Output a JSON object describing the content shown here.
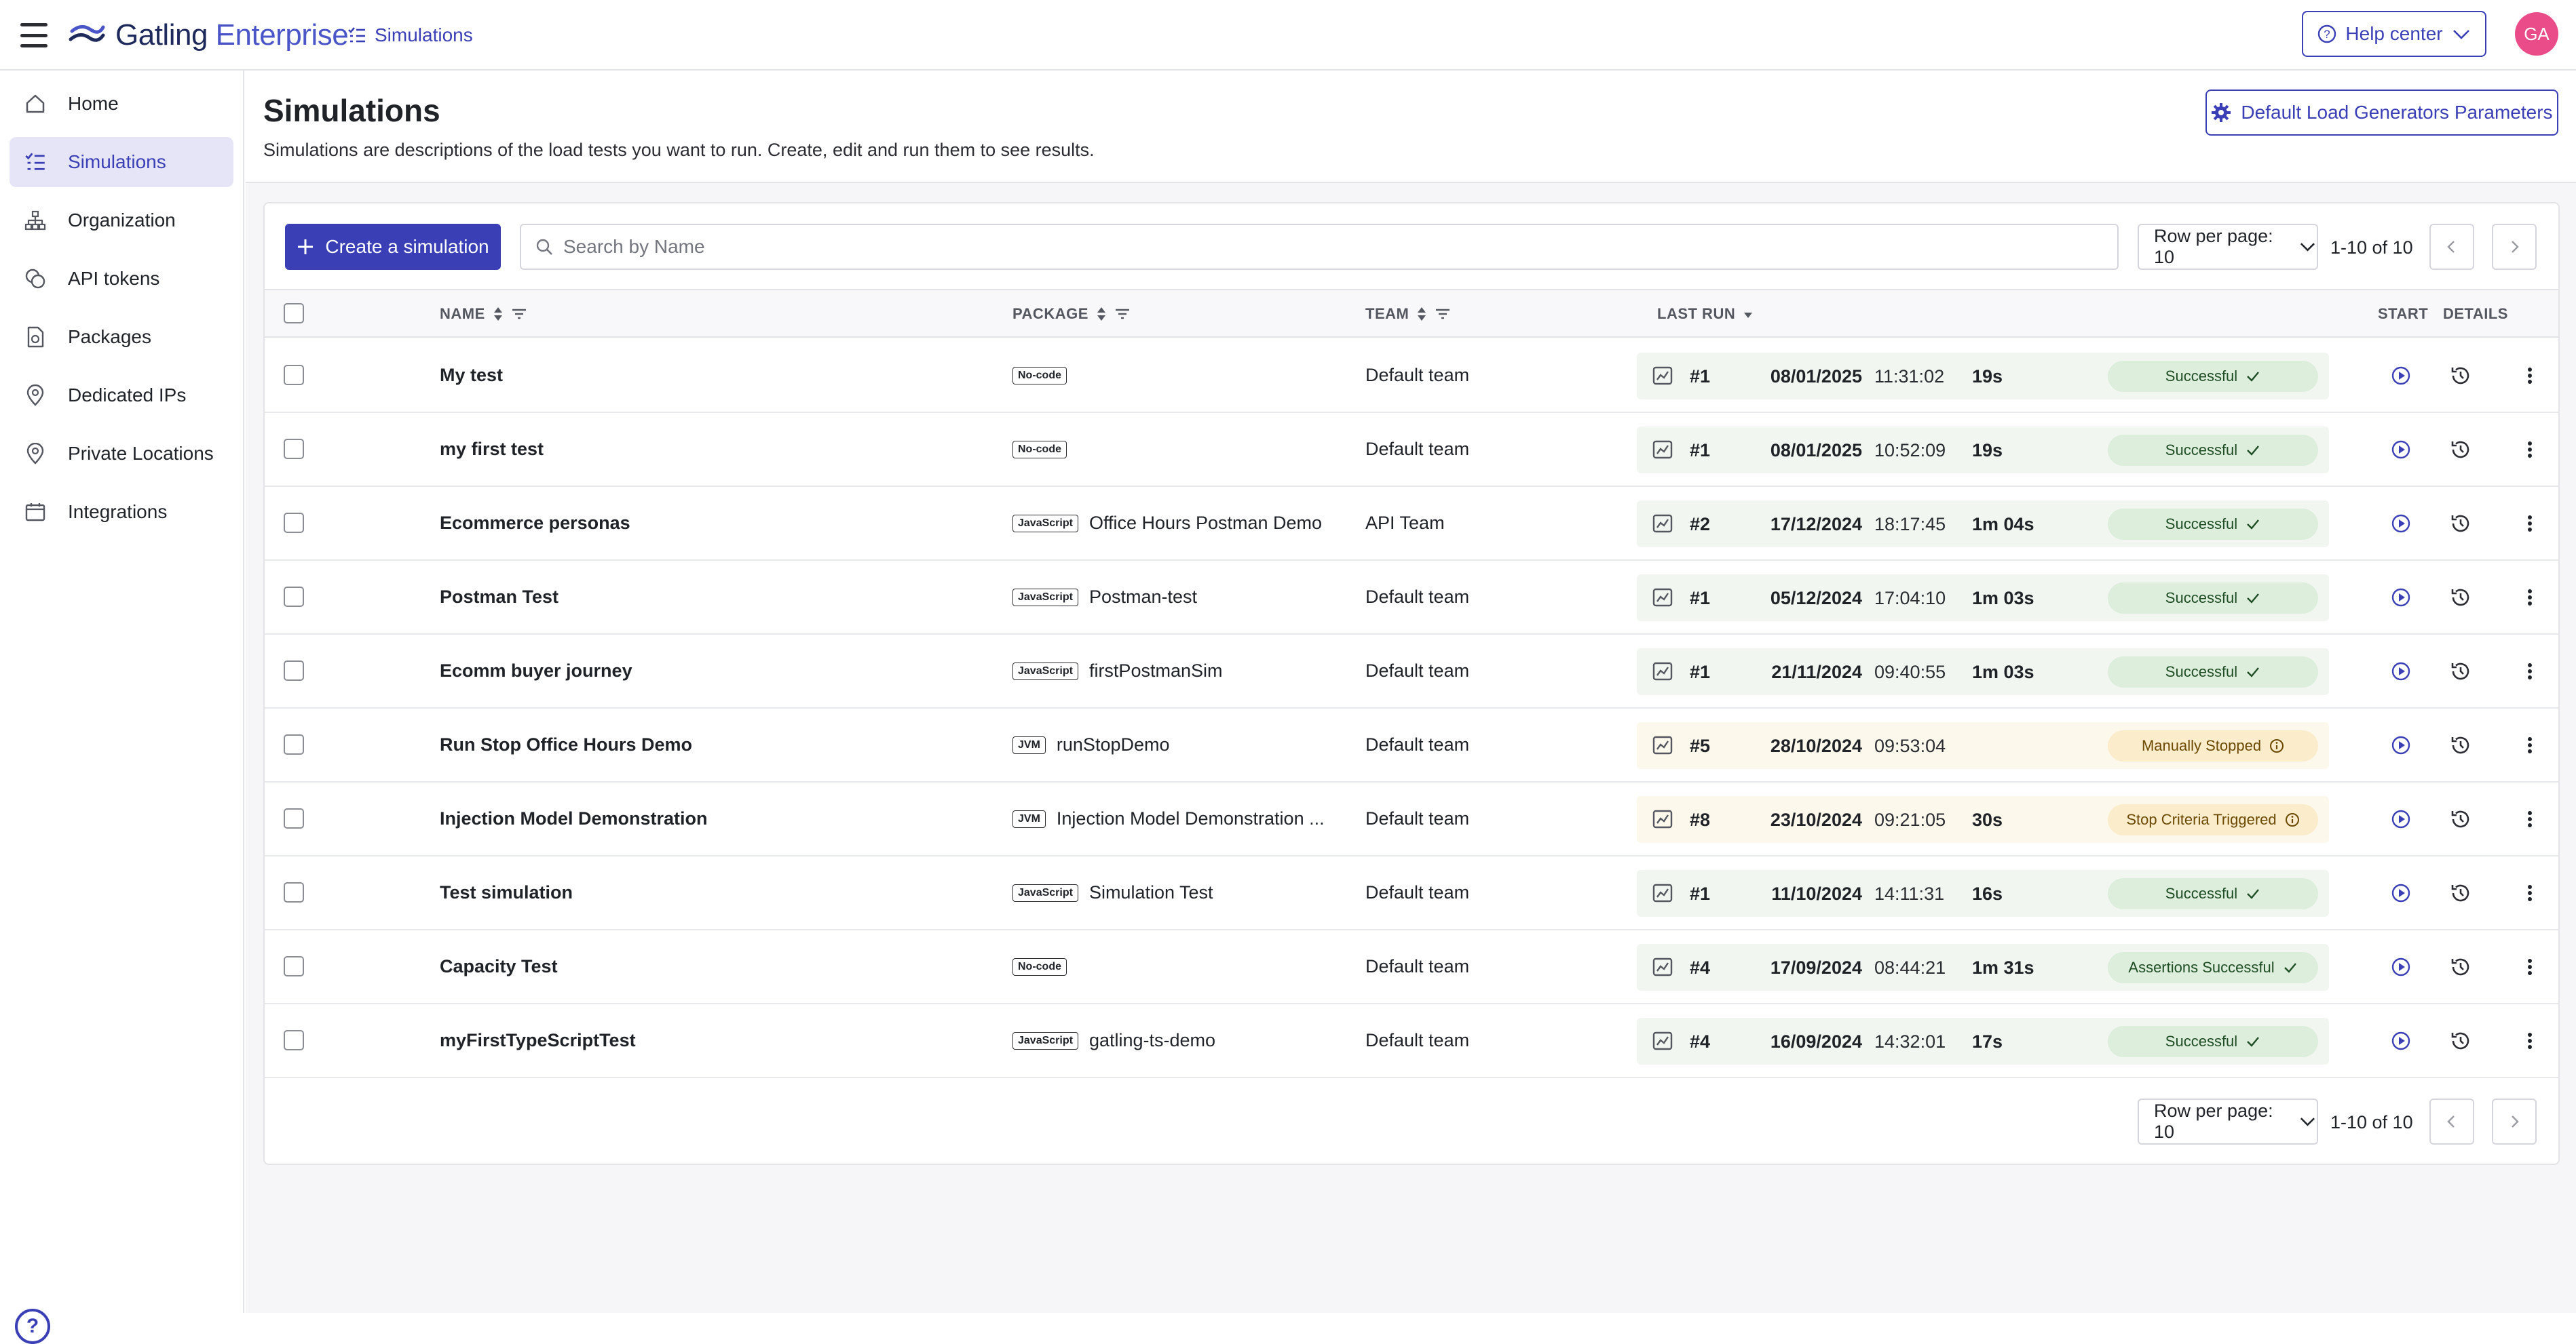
{
  "app": {
    "brand_main": "Gatling",
    "brand_sub": "Enterprise",
    "breadcrumb": "Simulations",
    "help_center": "Help center",
    "avatar_initials": "GA",
    "accent_color": "#3b3fb6"
  },
  "sidebar": {
    "items": [
      {
        "label": "Home",
        "icon": "home-icon"
      },
      {
        "label": "Simulations",
        "icon": "list-check-icon",
        "active": true
      },
      {
        "label": "Organization",
        "icon": "org-chart-icon"
      },
      {
        "label": "API tokens",
        "icon": "tokens-icon"
      },
      {
        "label": "Packages",
        "icon": "package-icon"
      },
      {
        "label": "Dedicated IPs",
        "icon": "location-pin-icon"
      },
      {
        "label": "Private Locations",
        "icon": "location-pin-icon"
      },
      {
        "label": "Integrations",
        "icon": "calendar-icon"
      }
    ],
    "help_symbol": "?"
  },
  "page": {
    "title": "Simulations",
    "description": "Simulations are descriptions of the load tests you want to run. Create, edit and run them to see results.",
    "default_params_button": "Default Load Generators Parameters"
  },
  "toolbar": {
    "create_button": "Create a simulation",
    "search_placeholder": "Search by Name",
    "search_value": "",
    "rows_per_page": "Row per page: 10",
    "range": "1-10 of 10"
  },
  "table": {
    "columns": {
      "name": "NAME",
      "package": "PACKAGE",
      "team": "TEAM",
      "last_run": "LAST RUN",
      "start": "START",
      "details": "DETAILS"
    },
    "rows": [
      {
        "name": "My test",
        "package_tag": "No-code",
        "package_name": "",
        "team": "Default team",
        "run": "#1",
        "date": "08/01/2025",
        "time": "11:31:02",
        "duration": "19s",
        "status": "Successful",
        "status_kind": "ok"
      },
      {
        "name": "my first test",
        "package_tag": "No-code",
        "package_name": "",
        "team": "Default team",
        "run": "#1",
        "date": "08/01/2025",
        "time": "10:52:09",
        "duration": "19s",
        "status": "Successful",
        "status_kind": "ok"
      },
      {
        "name": "Ecommerce personas",
        "package_tag": "JavaScript",
        "package_name": "Office Hours Postman Demo",
        "team": "API Team",
        "run": "#2",
        "date": "17/12/2024",
        "time": "18:17:45",
        "duration": "1m 04s",
        "status": "Successful",
        "status_kind": "ok"
      },
      {
        "name": "Postman Test",
        "package_tag": "JavaScript",
        "package_name": "Postman-test",
        "team": "Default team",
        "run": "#1",
        "date": "05/12/2024",
        "time": "17:04:10",
        "duration": "1m 03s",
        "status": "Successful",
        "status_kind": "ok"
      },
      {
        "name": "Ecomm buyer journey",
        "package_tag": "JavaScript",
        "package_name": "firstPostmanSim",
        "team": "Default team",
        "run": "#1",
        "date": "21/11/2024",
        "time": "09:40:55",
        "duration": "1m 03s",
        "status": "Successful",
        "status_kind": "ok"
      },
      {
        "name": "Run Stop Office Hours Demo",
        "package_tag": "JVM",
        "package_name": "runStopDemo",
        "team": "Default team",
        "run": "#5",
        "date": "28/10/2024",
        "time": "09:53:04",
        "duration": "",
        "status": "Manually Stopped",
        "status_kind": "warn"
      },
      {
        "name": "Injection Model Demonstration",
        "package_tag": "JVM",
        "package_name": "Injection Model Demonstration ...",
        "team": "Default team",
        "run": "#8",
        "date": "23/10/2024",
        "time": "09:21:05",
        "duration": "30s",
        "status": "Stop Criteria Triggered",
        "status_kind": "warn"
      },
      {
        "name": "Test simulation",
        "package_tag": "JavaScript",
        "package_name": "Simulation Test",
        "team": "Default team",
        "run": "#1",
        "date": "11/10/2024",
        "time": "14:11:31",
        "duration": "16s",
        "status": "Successful",
        "status_kind": "ok"
      },
      {
        "name": "Capacity Test",
        "package_tag": "No-code",
        "package_name": "",
        "team": "Default team",
        "run": "#4",
        "date": "17/09/2024",
        "time": "08:44:21",
        "duration": "1m 31s",
        "status": "Assertions Successful",
        "status_kind": "ok"
      },
      {
        "name": "myFirstTypeScriptTest",
        "package_tag": "JavaScript",
        "package_name": "gatling-ts-demo",
        "team": "Default team",
        "run": "#4",
        "date": "16/09/2024",
        "time": "14:32:01",
        "duration": "17s",
        "status": "Successful",
        "status_kind": "ok"
      }
    ]
  },
  "footer": {
    "rows_per_page": "Row per page: 10",
    "range": "1-10 of 10"
  }
}
